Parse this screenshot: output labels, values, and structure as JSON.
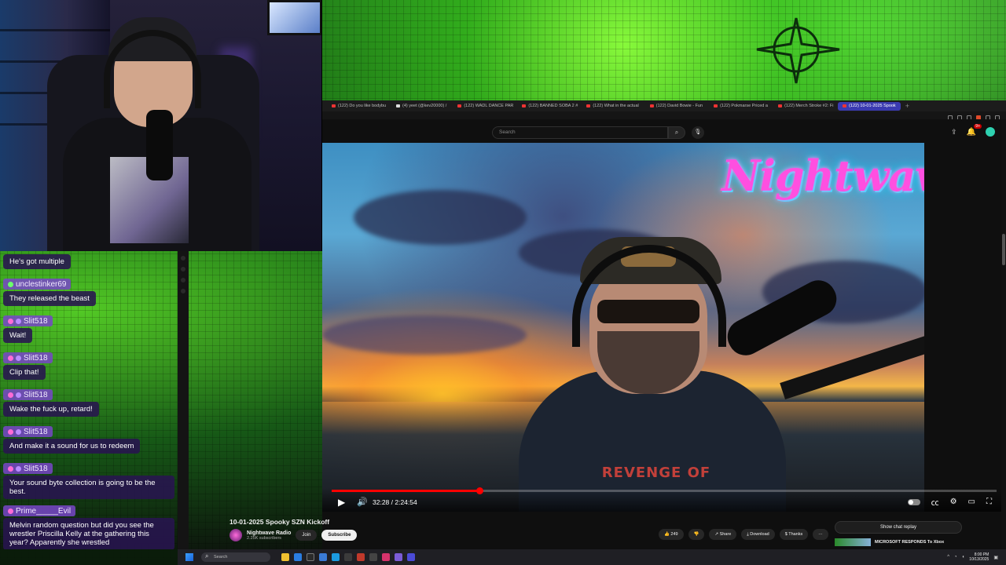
{
  "browser": {
    "tabs": [
      {
        "label": "(122) Do you like bodybu"
      },
      {
        "label": "(4) yeet (@kev20000) /"
      },
      {
        "label": "(122) WADL DANCE PAR"
      },
      {
        "label": "(122) BANNED SOBA 2 #"
      },
      {
        "label": "(122) What in the actual"
      },
      {
        "label": "(122) David Bowie - Fun"
      },
      {
        "label": "(122) Pokmarse Priced a"
      },
      {
        "label": "(122) Merch Stroke #2: Fi"
      },
      {
        "label": "(122) 10-01-2025 Spook"
      }
    ],
    "new_tab": "+"
  },
  "youtube": {
    "search_placeholder": "Search",
    "search_icon": "⌕",
    "mic_icon": "🎙",
    "notification_count": "9+",
    "video_logo": "Nightwave",
    "shirt_text": "REVENGE OF",
    "controls": {
      "time": "32:28 / 2:24:54",
      "progress_fraction": 0.222
    },
    "title": "10-01-2025 Spooky SZN Kickoff",
    "channel": {
      "name": "Nightwave Radio",
      "subscribers": "2.25K subscribers",
      "join": "Join",
      "subscribe": "Subscribe"
    },
    "actions": {
      "likes": "249",
      "share": "Share",
      "download": "Download",
      "thanks": "Thanks",
      "more": "···"
    },
    "side": {
      "chat_replay": "Show chat replay",
      "rec_title": "MICROSOFT RESPONDS To Xbox"
    }
  },
  "chat": {
    "messages": [
      {
        "name": "",
        "text": "He's got multiple"
      },
      {
        "name": "unclestinker69",
        "text": "They released the beast"
      },
      {
        "name": "Slit518",
        "text": "Wait!"
      },
      {
        "name": "Slit518",
        "text": "Clip that!"
      },
      {
        "name": "Slit518",
        "text": "Wake the fuck up, retard!"
      },
      {
        "name": "Slit518",
        "text": "And make it a sound for us to redeem"
      },
      {
        "name": "Slit518",
        "text": "Your sound byte collection is going to be the best."
      },
      {
        "name": "Prime_____Evil",
        "text": "Melvin random question but did you see the wrestler Priscilla Kelly at the gathering this year? Apparently she wrestled"
      }
    ]
  },
  "taskbar": {
    "search_placeholder": "Search",
    "time": "8:00 PM",
    "date": "10/13/2025"
  },
  "colors": {
    "accent_red": "#ff0000",
    "chat_name_bg": "#7846c8",
    "logo_pink": "#ff4fe0"
  }
}
